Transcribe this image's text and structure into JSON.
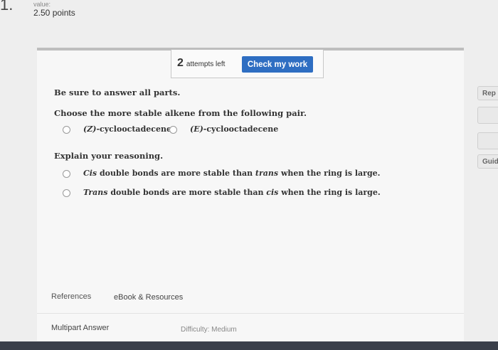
{
  "question": {
    "number": "1.",
    "value_label": "value:",
    "points": "2.50 points"
  },
  "attempts": {
    "count": "2",
    "label": "attempts left",
    "check_button": "Check my work"
  },
  "content": {
    "instruction": "Be sure to answer all parts.",
    "prompt": "Choose the more stable alkene from the following pair.",
    "choices": [
      {
        "prefix": "(Z)",
        "suffix": "-cyclooctadecene"
      },
      {
        "prefix": "(E)",
        "suffix": "-cyclooctadecene"
      }
    ],
    "explain_prompt": "Explain your reasoning.",
    "reasons": [
      {
        "word1": "Cis",
        "mid": " double bonds are more stable than ",
        "word2": "trans",
        "end": " when the ring is large."
      },
      {
        "word1": "Trans",
        "mid": " double bonds are more stable than ",
        "word2": "cis",
        "end": " when the ring is large."
      }
    ]
  },
  "footer": {
    "references_tab": "References",
    "ebook_tab": "eBook & Resources",
    "question_type": "Multipart Answer",
    "difficulty": "Difficulty: Medium"
  },
  "sidebar": {
    "report_label": "Rep",
    "guide_label": "Guid"
  }
}
